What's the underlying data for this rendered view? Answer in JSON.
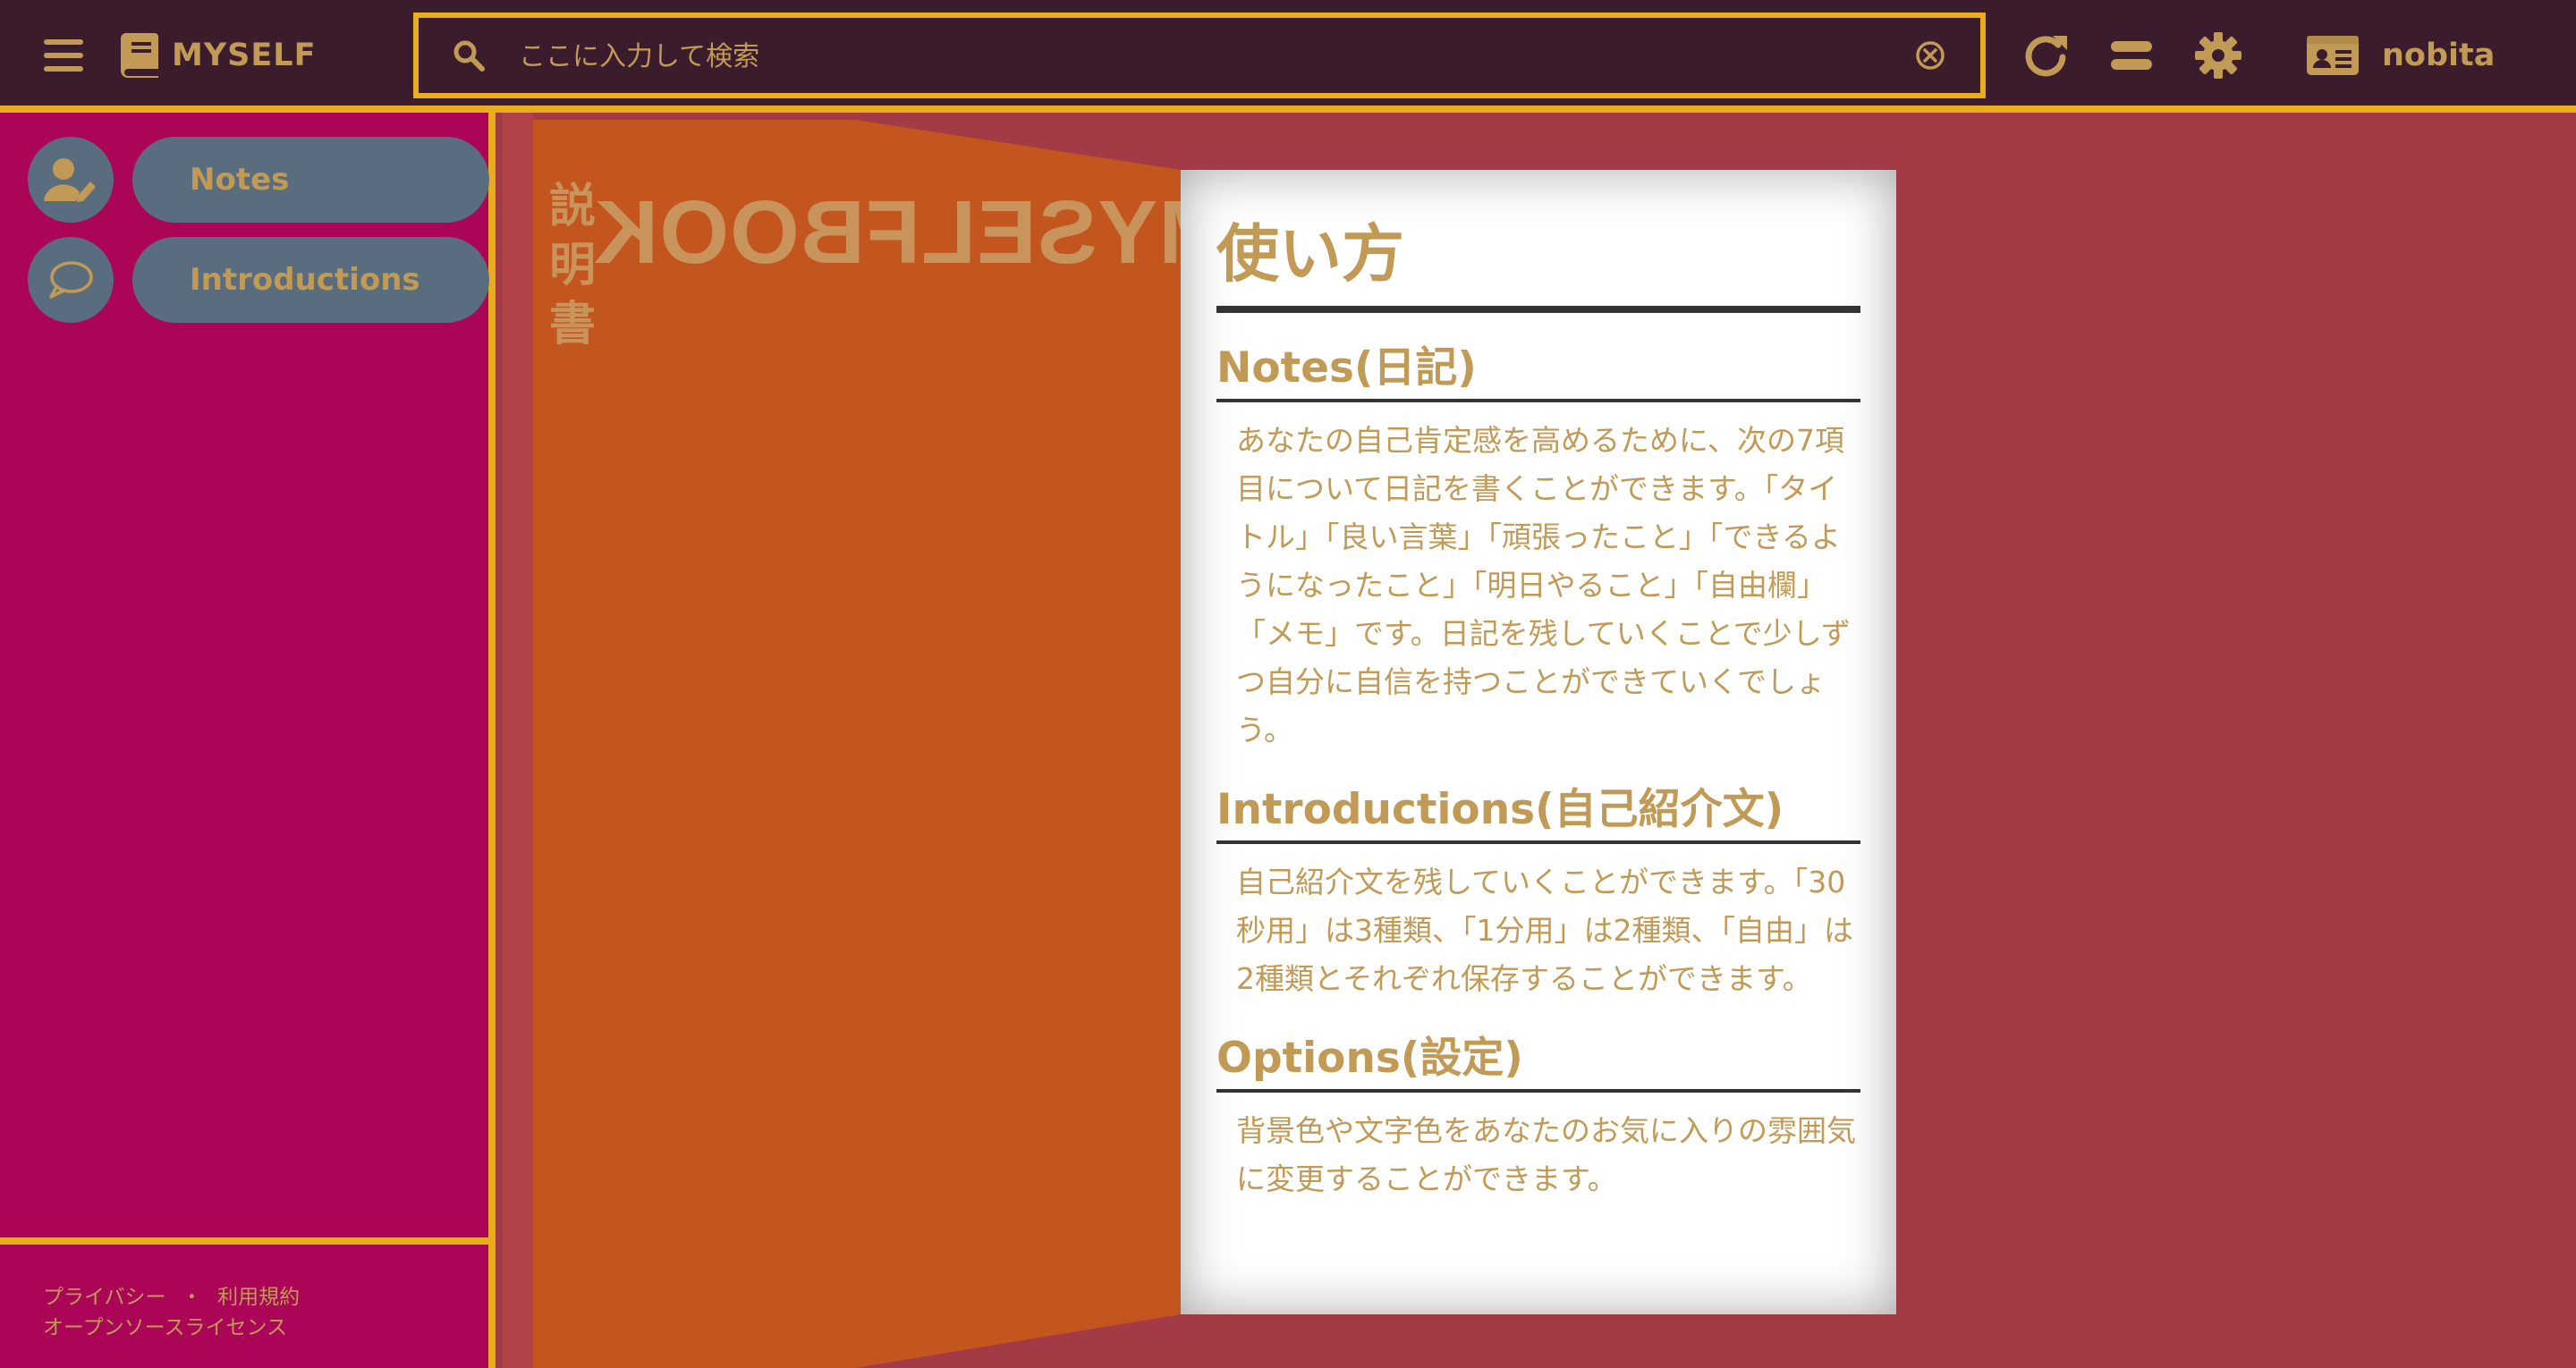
{
  "header": {
    "brand": "MYSELF",
    "search_placeholder": "ここに入力して検索",
    "username": "nobita",
    "icons": [
      "menu-icon",
      "book-icon",
      "search-icon",
      "clear-icon",
      "refresh-icon",
      "equal-icon",
      "gear-icon",
      "id-card-icon"
    ]
  },
  "sidebar": {
    "items": [
      {
        "label": "Notes",
        "icon": "user-edit-icon"
      },
      {
        "label": "Introductions",
        "icon": "chat-bubble-icon"
      }
    ],
    "footer": {
      "privacy": "プライバシー",
      "separator": "・",
      "terms": "利用規約",
      "oss": "オープンソースライセンス"
    }
  },
  "cover": {
    "title": "MYSELFBOOK",
    "subtitle": "説明書"
  },
  "manual": {
    "title": "使い方",
    "sections": [
      {
        "heading": "Notes(日記)",
        "body": "あなたの自己肯定感を高めるために、次の7項目について日記を書くことができます。「タイトル」「良い言葉」「頑張ったこと」「できるようになったこと」「明日やること」「自由欄」「メモ」です。日記を残していくことで少しずつ自分に自信を持つことができていくでしょう。"
      },
      {
        "heading": "Introductions(自己紹介文)",
        "body": "自己紹介文を残していくことができます。「30秒用」は3種類、「1分用」は2種類、「自由」は2種類とそれぞれ保存することができます。"
      },
      {
        "heading": "Options(設定)",
        "body": "背景色や文字色をあなたのお気に入りの雰囲気に変更することができます。"
      }
    ]
  },
  "colors": {
    "topbar": "#3b1c2d",
    "accent_border": "#e8ac1c",
    "sidebar": "#ab0558",
    "pill": "#5a6d7e",
    "background": "#a33b47",
    "cover": "#c2561e",
    "text": "#c19a55"
  }
}
